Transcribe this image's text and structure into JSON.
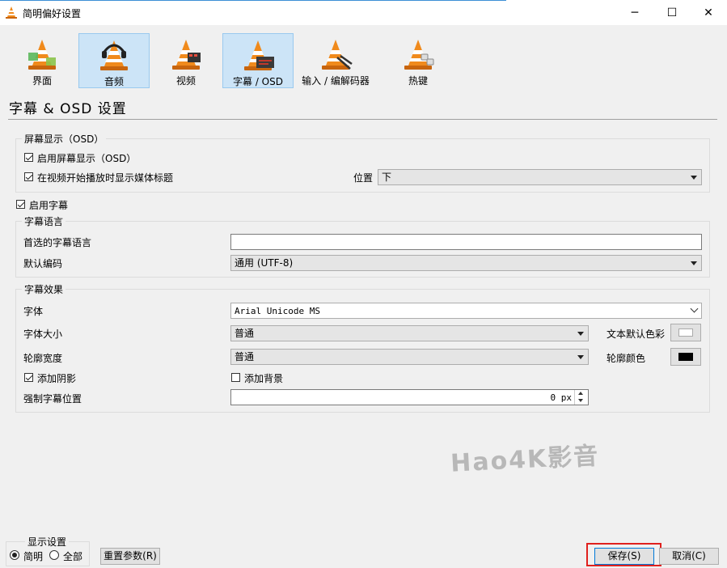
{
  "window": {
    "title": "简明偏好设置",
    "minimize_glyph": "─",
    "maximize_glyph": "☐",
    "close_glyph": "✕"
  },
  "categories": [
    {
      "label": "界面",
      "icon": "vlc-cone-interface-icon",
      "active": false
    },
    {
      "label": "音频",
      "icon": "vlc-cone-audio-icon",
      "active": true
    },
    {
      "label": "视频",
      "icon": "vlc-cone-video-icon",
      "active": false
    },
    {
      "label": "字幕 / OSD",
      "icon": "vlc-cone-subtitle-icon",
      "active": true
    },
    {
      "label": "输入 / 编解码器",
      "icon": "vlc-cone-codec-icon",
      "active": false
    },
    {
      "label": "热键",
      "icon": "vlc-cone-hotkeys-icon",
      "active": false
    }
  ],
  "section_title": "字幕 & OSD 设置",
  "osd": {
    "group_title": "屏幕显示（OSD）",
    "enable_osd_label": "启用屏幕显示（OSD）",
    "enable_osd_checked": true,
    "show_title_label": "在视频开始播放时显示媒体标题",
    "show_title_checked": true,
    "position_label": "位置",
    "position_value": "下"
  },
  "enable_subtitles": {
    "label": "启用字幕",
    "checked": true
  },
  "subtitle_language": {
    "group_title": "字幕语言",
    "preferred_label": "首选的字幕语言",
    "preferred_value": "",
    "encoding_label": "默认编码",
    "encoding_value": "通用 (UTF-8)"
  },
  "subtitle_effects": {
    "group_title": "字幕效果",
    "font_label": "字体",
    "font_value": "Arial Unicode MS",
    "font_size_label": "字体大小",
    "font_size_value": "普通",
    "text_color_label": "文本默认色彩",
    "text_color": "#ffffff",
    "outline_width_label": "轮廓宽度",
    "outline_width_value": "普通",
    "outline_color_label": "轮廓颜色",
    "outline_color": "#000000",
    "shadow_label": "添加阴影",
    "shadow_checked": true,
    "background_label": "添加背景",
    "background_checked": false,
    "force_position_label": "强制字幕位置",
    "force_position_value": "0 px"
  },
  "footer": {
    "display_group_title": "显示设置",
    "simple_label": "简明",
    "simple_checked": true,
    "all_label": "全部",
    "all_checked": false,
    "reset_label": "重置参数(R)",
    "save_label": "保存(S)",
    "cancel_label": "取消(C)"
  },
  "watermark": "Hao4K影音",
  "colors": {
    "active_tab_bg": "#cce4f7",
    "highlight_border": "#e0201d",
    "cone_orange": "#f08a1c"
  }
}
